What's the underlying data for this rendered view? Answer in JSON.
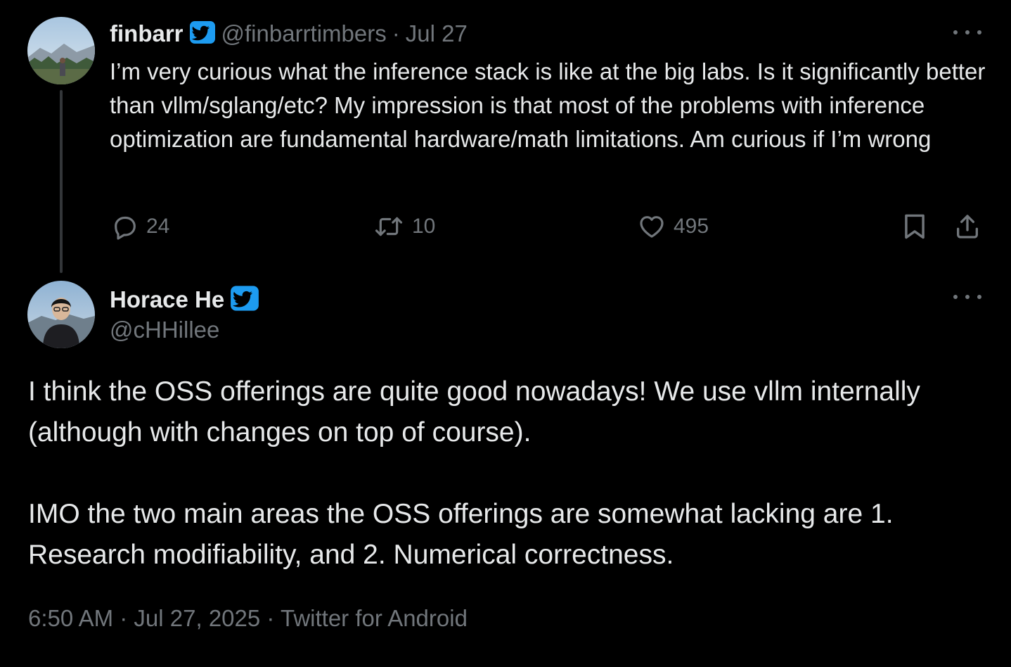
{
  "tweet1": {
    "author_name": "finbarr",
    "handle": "@finbarrtimbers",
    "separator": "·",
    "date": "Jul 27",
    "text": "I’m very curious what the inference stack is like at the big labs. Is it significantly better than vllm/sglang/etc? My impression is that most of the problems with inference optimization are fundamental hardware/math limitations. Am curious if I’m wrong",
    "reply_count": "24",
    "retweet_count": "10",
    "like_count": "495"
  },
  "tweet2": {
    "author_name": "Horace He",
    "handle": "@cHHillee",
    "paragraph1": "I think the OSS offerings are quite good nowadays! We use vllm internally (although with changes on top of course).",
    "paragraph2": "IMO the two main areas the OSS offerings are somewhat lacking are 1. Research modifiability, and 2. Numerical correctness.",
    "time": "6:50 AM",
    "separator": "·",
    "date": "Jul 27, 2025",
    "source": "Twitter for Android"
  },
  "colors": {
    "background": "#000000",
    "text": "#e7e9ea",
    "muted": "#71767b",
    "verified": "#1d9bf0"
  },
  "icons": [
    "more-icon",
    "verified-badge-icon",
    "reply-icon",
    "retweet-icon",
    "like-icon",
    "bookmark-icon",
    "share-icon"
  ]
}
